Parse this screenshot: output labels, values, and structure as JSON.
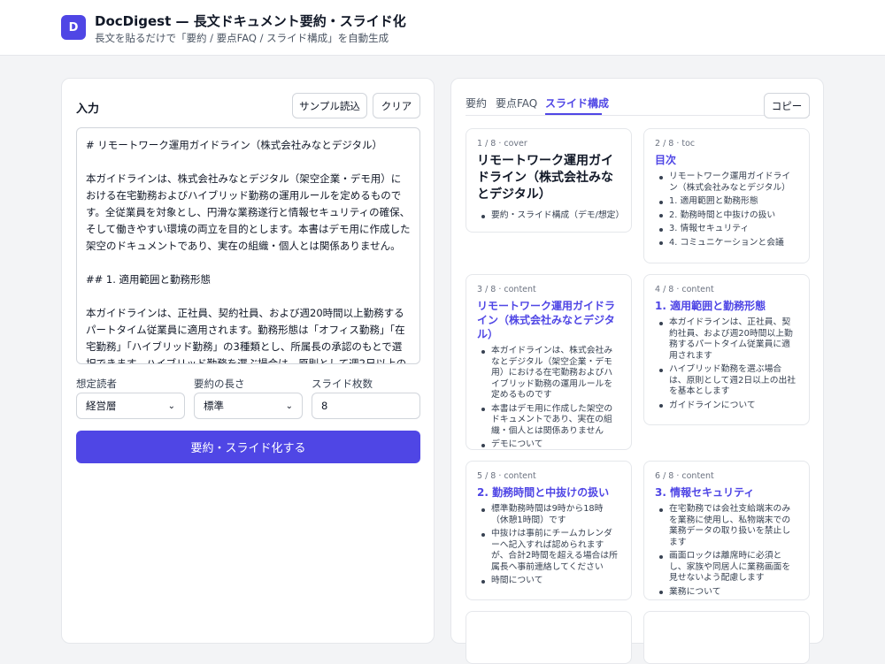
{
  "app": {
    "logo": "D",
    "title": "DocDigest — 長文ドキュメント要約・スライド化",
    "subtitle": "長文を貼るだけで「要約 / 要点FAQ / スライド構成」を自動生成"
  },
  "input": {
    "title": "入力",
    "sample_button": "サンプル読込",
    "clear_button": "クリア",
    "text": "# リモートワーク運用ガイドライン（株式会社みなとデジタル）\n\n本ガイドラインは、株式会社みなとデジタル（架空企業・デモ用）における在宅勤務およびハイブリッド勤務の運用ルールを定めるものです。全従業員を対象とし、円滑な業務遂行と情報セキュリティの確保、そして働きやすい環境の両立を目的とします。本書はデモ用に作成した架空のドキュメントであり、実在の組織・個人とは関係ありません。\n\n## 1. 適用範囲と勤務形態\n\n本ガイドラインは、正社員、契約社員、および週20時間以上勤務するパートタイム従業員に適用されます。勤務形態は「オフィス勤務」「在宅勤務」「ハイブリッド勤務」の3種類とし、所属長の承認のもとで選択できます。ハイブリッド勤務を選ぶ場合は、原則として週2日以上の出社を基本とします。新入社員は入社後3か月間はオフィス勤務を基本とし、業務習熟とチー",
    "audience_label": "想定読者",
    "audience_value": "経営層",
    "length_label": "要約の長さ",
    "length_value": "標準",
    "slides_label": "スライド枚数",
    "slides_value": "8",
    "submit_button": "要約・スライド化する"
  },
  "output": {
    "tabs": [
      "要約",
      "要点FAQ",
      "スライド構成"
    ],
    "active_tab": "スライド構成",
    "copy_button": "コピー",
    "slides": [
      {
        "meta": "1 / 8 · cover",
        "title": "リモートワーク運用ガイドライン（株式会社みなとデジタル）",
        "bullets": [
          "要約・スライド構成（デモ/想定）"
        ]
      },
      {
        "meta": "2 / 8 · toc",
        "title": "目次",
        "bullets": [
          "リモートワーク運用ガイドライン（株式会社みなとデジタル）",
          "1. 適用範囲と勤務形態",
          "2. 勤務時間と中抜けの扱い",
          "3. 情報セキュリティ",
          "4. コミュニケーションと会議"
        ]
      },
      {
        "meta": "3 / 8 · content",
        "title": "リモートワーク運用ガイドライン（株式会社みなとデジタル）",
        "bullets": [
          "本ガイドラインは、株式会社みなとデジタル（架空企業・デモ用）における在宅勤務およびハイブリッド勤務の運用ルールを定めるものです",
          "本書はデモ用に作成した架空のドキュメントであり、実在の組織・個人とは関係ありません",
          "デモについて"
        ]
      },
      {
        "meta": "4 / 8 · content",
        "title": "1. 適用範囲と勤務形態",
        "bullets": [
          "本ガイドラインは、正社員、契約社員、および週20時間以上勤務するパートタイム従業員に適用されます",
          "ハイブリッド勤務を選ぶ場合は、原則として週2日以上の出社を基本とします",
          "ガイドラインについて"
        ]
      },
      {
        "meta": "5 / 8 · content",
        "title": "2. 勤務時間と中抜けの扱い",
        "bullets": [
          "標準勤務時間は9時から18時（休憩1時間）です",
          "中抜けは事前にチームカレンダーへ記入すれば認められますが、合計2時間を超える場合は所属長へ事前連絡してください",
          "時間について"
        ]
      },
      {
        "meta": "6 / 8 · content",
        "title": "3. 情報セキュリティ",
        "bullets": [
          "在宅勤務では会社支給端末のみを業務に使用し、私物端末での業務データの取り扱いを禁止します",
          "画面ロックは離席時に必須とし、家族や同居人に業務画面を見せないよう配慮します",
          "業務について"
        ]
      }
    ]
  }
}
